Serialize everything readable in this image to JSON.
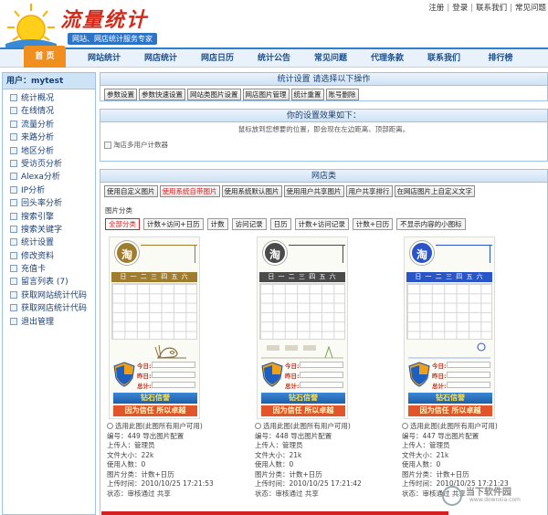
{
  "header": {
    "logo_title": "流量统计",
    "slogan": "网站、网店统计服务专家",
    "top_links": [
      "注册",
      "登录",
      "联系我们",
      "常见问题"
    ]
  },
  "nav": [
    "首 页",
    "网站统计",
    "网店统计",
    "网店日历",
    "统计公告",
    "常见问题",
    "代理条款",
    "联系我们",
    "排行榜"
  ],
  "sidebar": {
    "user_label": "用户：mytest",
    "items": [
      "统计概况",
      "在线情况",
      "流量分析",
      "来路分析",
      "地区分析",
      "受访页分析",
      "Alexa分析",
      "IP分析",
      "回头率分析",
      "搜索引擎",
      "搜索关键字",
      "统计设置",
      "修改资料",
      "充值卡",
      "留言列表 (7)",
      "获取网站统计代码",
      "获取网店统计代码",
      "退出管理"
    ]
  },
  "settings": {
    "title": "统计设置 请选择以下操作",
    "buttons": [
      "参数设置",
      "参数快速设置",
      "网站类图片设置",
      "网店图片管理",
      "统计重置",
      "账号删除"
    ]
  },
  "preview": {
    "title": "你的设置效果如下：",
    "hint": "鼠标放到您想要的位置，即会现在左边距离、顶部距离。",
    "image_alt": "淘店多用户计数器"
  },
  "shop": {
    "title": "网店类",
    "buttons": [
      "使用自定义图片",
      "使用系统自带图片",
      "使用系统默认图片",
      "使用用户共享图片",
      "用户共享排行",
      "在网店图片上自定义文字"
    ],
    "active_button": "使用系统自带图片",
    "category_label": "图片分类",
    "filters": [
      "全部分类",
      "计数+访问+日历",
      "计数",
      "访问记录",
      "日历",
      "计数+访问记录",
      "计数+日历",
      "不显示内容的小图标"
    ],
    "active_filter": "全部分类"
  },
  "card_common": {
    "badge": "淘",
    "weekdays": "日 一 二 三 四 五 六",
    "today": "今日:",
    "yesterday": "昨日:",
    "total": "总计:",
    "banner1": "钻石信誉",
    "banner2": "因为信任 所以卓越"
  },
  "cards": [
    {
      "select": "选用此图(此图所有用户可用)",
      "code": "编号：449   导出图片配置",
      "uploader": "上传人：管理员",
      "size": "文件大小：22k",
      "users": "使用人数：0",
      "category": "图片分类：计数+日历",
      "time": "上传时间：2010/10/25 17:21:53",
      "status": "状态：审核通过  共享",
      "theme": "#a07d2e"
    },
    {
      "select": "选用此图(此图所有用户可用)",
      "code": "编号：448   导出图片配置",
      "uploader": "上传人：管理员",
      "size": "文件大小：21k",
      "users": "使用人数：0",
      "category": "图片分类：计数+日历",
      "time": "上传时间：2010/10/25 17:21:42",
      "status": "状态：审核通过  共享",
      "theme": "#4a4a4a"
    },
    {
      "select": "选用此图(此图所有用户可用)",
      "code": "编号：447   导出图片配置",
      "uploader": "上传人：管理员",
      "size": "文件大小：21k",
      "users": "使用人数：0",
      "category": "图片分类：计数+日历",
      "time": "上传时间：2010/10/25 17:21:23",
      "status": "状态：审核通过  共享",
      "theme": "#2a55c7"
    }
  ],
  "watermark": {
    "text": "当下软件园",
    "sub": "www.downxia.com"
  },
  "colors": {
    "accent": "#f08f1e",
    "nav_border": "#2e7fd0",
    "active_red": "#d42020"
  }
}
